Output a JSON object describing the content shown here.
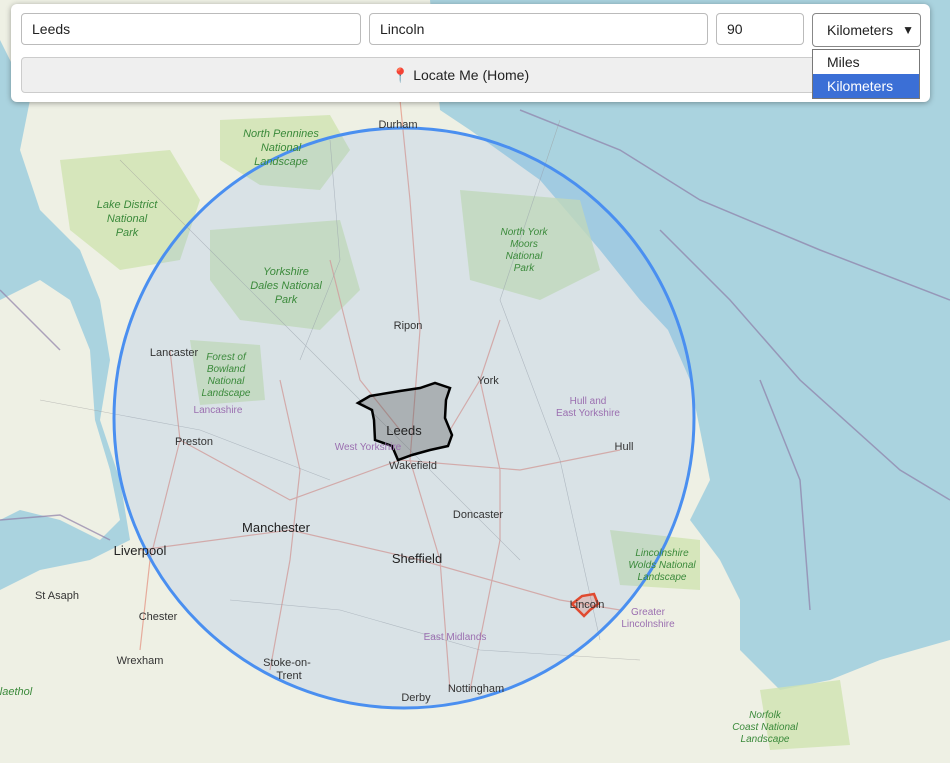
{
  "form": {
    "from_value": "Leeds",
    "to_value": "Lincoln",
    "distance_value": "90",
    "unit_selected": "Kilometers",
    "locate_icon": "pin-icon",
    "locate_label": "Locate Me (Home)",
    "unit_options": [
      "Miles",
      "Kilometers"
    ]
  },
  "colors": {
    "radius_circle": "#4a8ff0",
    "origin_outline": "#000000",
    "destination_outline": "#e04a30",
    "selected_option": "#3b6fd6"
  },
  "map": {
    "places": [
      "Durham",
      "Ripon",
      "York",
      "Lancaster",
      "Preston",
      "Leeds",
      "Wakefield",
      "Hull",
      "Doncaster",
      "Manchester",
      "Liverpool",
      "Sheffield",
      "St Asaph",
      "Chester",
      "Wrexham",
      "Stoke-on-",
      "Trent",
      "Derby",
      "Nottingham",
      "Lincoln"
    ],
    "parks": [
      [
        "North Pennines",
        "National",
        "Landscape"
      ],
      [
        "Lake District",
        "National",
        "Park"
      ],
      [
        "Yorkshire",
        "Dales National",
        "Park"
      ],
      [
        "North York",
        "Moors",
        "National",
        "Park"
      ],
      [
        "Forest of",
        "Bowland",
        "National",
        "Landscape"
      ],
      [
        "Lincolnshire",
        "Wolds National",
        "Landscape"
      ],
      [
        "Norfolk",
        "Coast National",
        "Landscape"
      ],
      [
        "laethol"
      ]
    ],
    "regions": [
      "Lancashire",
      "West Yorkshire",
      "Hull and",
      "East Yorkshire",
      "East Midlands",
      "Greater",
      "Lincolnshire"
    ]
  }
}
